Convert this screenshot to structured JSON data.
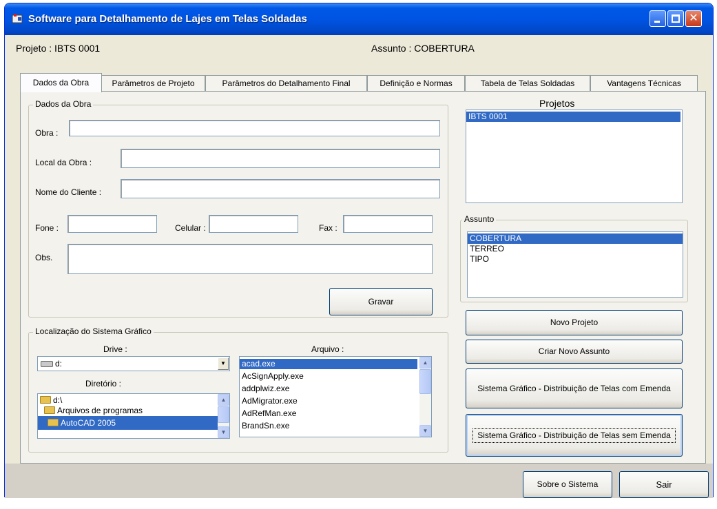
{
  "window": {
    "title": "Software para Detalhamento de Lajes em Telas Soldadas",
    "close_glyph": "✕"
  },
  "header": {
    "projeto": "Projeto : IBTS 0001",
    "assunto": "Assunto : COBERTURA"
  },
  "tabs": [
    {
      "label": "Dados da Obra"
    },
    {
      "label": "Parâmetros de Projeto"
    },
    {
      "label": "Parâmetros do Detalhamento Final"
    },
    {
      "label": "Definição e Normas"
    },
    {
      "label": "Tabela de Telas Soldadas"
    },
    {
      "label": "Vantagens Técnicas"
    }
  ],
  "dados_obra": {
    "group_label": "Dados da Obra",
    "obra_label": "Obra :",
    "obra_value": "",
    "local_label": "Local da Obra :",
    "local_value": "",
    "cliente_label": "Nome do Cliente :",
    "cliente_value": "",
    "fone_label": "Fone :",
    "fone_value": "",
    "celular_label": "Celular :",
    "celular_value": "",
    "fax_label": "Fax :",
    "fax_value": "",
    "obs_label": "Obs.",
    "obs_value": "",
    "gravar_label": "Gravar"
  },
  "localizacao": {
    "group_label": "Localização do Sistema Gráfico",
    "drive_label": "Drive :",
    "drive_value": "d:",
    "diretorio_label": "Diretório :",
    "dirs": [
      "d:\\",
      "Arquivos de programas",
      "AutoCAD 2005"
    ],
    "arquivo_label": "Arquivo :",
    "files": [
      "acad.exe",
      "AcSignApply.exe",
      "addplwiz.exe",
      "AdMigrator.exe",
      "AdRefMan.exe",
      "BrandSn.exe"
    ]
  },
  "projetos": {
    "label": "Projetos",
    "items": [
      "IBTS 0001"
    ]
  },
  "assunto": {
    "label": "Assunto",
    "items": [
      "COBERTURA",
      "TERREO",
      "TIPO"
    ]
  },
  "actions": {
    "novo_projeto": "Novo Projeto",
    "criar_assunto": "Criar Novo Assunto",
    "com_emenda": "Sistema Gráfico - Distribuição de Telas com Emenda",
    "sem_emenda": "Sistema Gráfico - Distribuição de Telas sem Emenda"
  },
  "footer": {
    "sobre": "Sobre o Sistema",
    "sair": "Sair"
  },
  "colors": {
    "selection": "#316ac5",
    "titlebar": "#0054e3",
    "window_bg": "#ece9d8"
  }
}
